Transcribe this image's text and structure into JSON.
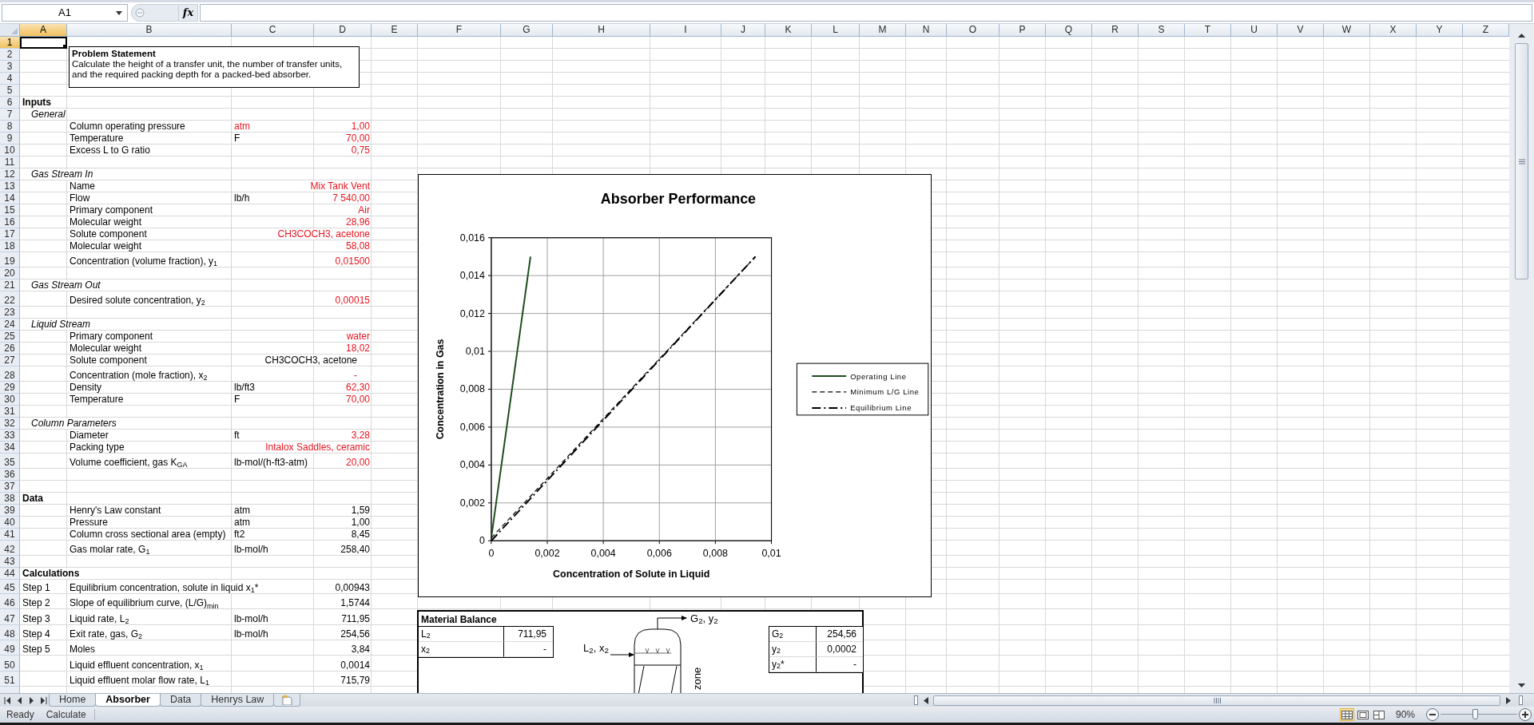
{
  "formula_bar": {
    "name_box": "A1",
    "function_label": "fx"
  },
  "columns": [
    {
      "label": "A",
      "selected": true
    },
    {
      "label": "B",
      "selected": false
    },
    {
      "label": "C",
      "selected": false
    },
    {
      "label": "D",
      "selected": false
    },
    {
      "label": "E",
      "selected": false
    },
    {
      "label": "F",
      "selected": false
    },
    {
      "label": "G",
      "selected": false
    },
    {
      "label": "H",
      "selected": false
    },
    {
      "label": "I",
      "selected": false
    },
    {
      "label": "J",
      "selected": false
    },
    {
      "label": "K",
      "selected": false
    },
    {
      "label": "L",
      "selected": false
    },
    {
      "label": "M",
      "selected": false
    },
    {
      "label": "N",
      "selected": false
    },
    {
      "label": "O",
      "selected": false
    },
    {
      "label": "P",
      "selected": false
    },
    {
      "label": "Q",
      "selected": false
    },
    {
      "label": "R",
      "selected": false
    },
    {
      "label": "S",
      "selected": false
    },
    {
      "label": "T",
      "selected": false
    },
    {
      "label": "U",
      "selected": false
    },
    {
      "label": "V",
      "selected": false
    },
    {
      "label": "W",
      "selected": false
    },
    {
      "label": "X",
      "selected": false
    },
    {
      "label": "Y",
      "selected": false
    },
    {
      "label": "Z",
      "selected": false
    }
  ],
  "rows": [
    {
      "number": "1",
      "selected": true,
      "cells": {}
    },
    {
      "number": "2",
      "selected": false,
      "cells": {}
    },
    {
      "number": "3",
      "selected": false,
      "cells": {}
    },
    {
      "number": "4",
      "selected": false,
      "cells": {}
    },
    {
      "number": "5",
      "selected": false,
      "cells": {}
    },
    {
      "number": "6",
      "selected": false,
      "cells": {
        "a": {
          "text": "Inputs",
          "input": false,
          "kind": "heading"
        }
      }
    },
    {
      "number": "7",
      "selected": false,
      "cells": {
        "a": {
          "text": "General",
          "input": false,
          "kind": "subheading"
        }
      }
    },
    {
      "number": "8",
      "selected": false,
      "cells": {
        "b": {
          "text": "Column operating pressure",
          "input": false
        },
        "c": {
          "text": "atm",
          "input": true
        },
        "d": {
          "text": "1,00",
          "input": true
        }
      }
    },
    {
      "number": "9",
      "selected": false,
      "cells": {
        "b": {
          "text": "Temperature",
          "input": false
        },
        "c": {
          "text": "F",
          "input": false
        },
        "d": {
          "text": "70,00",
          "input": true
        }
      }
    },
    {
      "number": "10",
      "selected": false,
      "cells": {
        "b": {
          "text": "Excess L to G ratio",
          "input": false
        },
        "d": {
          "text": "0,75",
          "input": true
        }
      }
    },
    {
      "number": "11",
      "selected": false,
      "cells": {}
    },
    {
      "number": "12",
      "selected": false,
      "cells": {
        "a": {
          "text": "Gas Stream In",
          "input": false,
          "kind": "subheading"
        }
      }
    },
    {
      "number": "13",
      "selected": false,
      "cells": {
        "b": {
          "text": "Name",
          "input": false
        },
        "d": {
          "text": "Mix Tank Vent",
          "input": true
        }
      }
    },
    {
      "number": "14",
      "selected": false,
      "cells": {
        "b": {
          "text": "Flow",
          "input": false
        },
        "c": {
          "text": "lb/h",
          "input": false
        },
        "d": {
          "text": "7 540,00",
          "input": true
        }
      }
    },
    {
      "number": "15",
      "selected": false,
      "cells": {
        "b": {
          "text": "Primary component",
          "input": false
        },
        "d": {
          "text": "Air",
          "input": true
        }
      }
    },
    {
      "number": "16",
      "selected": false,
      "cells": {
        "b": {
          "text": "Molecular weight",
          "input": false
        },
        "d": {
          "text": "28,96",
          "input": true
        }
      }
    },
    {
      "number": "17",
      "selected": false,
      "cells": {
        "b": {
          "text": "Solute component",
          "input": false
        },
        "d": {
          "text": "CH3COCH3, acetone",
          "input": true
        }
      }
    },
    {
      "number": "18",
      "selected": false,
      "cells": {
        "b": {
          "text": "Molecular weight",
          "input": false
        },
        "d": {
          "text": "58,08",
          "input": true
        }
      }
    },
    {
      "number": "19",
      "selected": false,
      "cells": {
        "b": {
          "text": "Concentration (volume fraction), y$_{1}$",
          "input": false
        },
        "d": {
          "text": "0,01500",
          "input": true
        }
      }
    },
    {
      "number": "20",
      "selected": false,
      "cells": {}
    },
    {
      "number": "21",
      "selected": false,
      "cells": {
        "a": {
          "text": "Gas Stream Out",
          "input": false,
          "kind": "subheading"
        }
      }
    },
    {
      "number": "22",
      "selected": false,
      "cells": {
        "b": {
          "text": "Desired solute concentration, y$_{2}$",
          "input": false
        },
        "d": {
          "text": "0,00015",
          "input": true
        }
      }
    },
    {
      "number": "23",
      "selected": false,
      "cells": {}
    },
    {
      "number": "24",
      "selected": false,
      "cells": {
        "a": {
          "text": "Liquid Stream",
          "input": false,
          "kind": "subheading"
        }
      }
    },
    {
      "number": "25",
      "selected": false,
      "cells": {
        "b": {
          "text": "Primary component",
          "input": false
        },
        "d": {
          "text": "water",
          "input": true
        }
      }
    },
    {
      "number": "26",
      "selected": false,
      "cells": {
        "b": {
          "text": "Molecular weight",
          "input": false
        },
        "d": {
          "text": "18,02",
          "input": true
        }
      }
    },
    {
      "number": "27",
      "selected": false,
      "cells": {
        "b": {
          "text": "Solute component",
          "input": false
        },
        "d": {
          "text": "CH3COCH3, acetone",
          "input": false,
          "kind": "accounting"
        }
      }
    },
    {
      "number": "28",
      "selected": false,
      "cells": {
        "b": {
          "text": "Concentration (mole fraction), x$_{2}$",
          "input": false
        },
        "d": {
          "text": "-",
          "input": true,
          "kind": "accounting"
        }
      }
    },
    {
      "number": "29",
      "selected": false,
      "cells": {
        "b": {
          "text": "Density",
          "input": false
        },
        "c": {
          "text": "lb/ft3",
          "input": false
        },
        "d": {
          "text": "62,30",
          "input": true
        }
      }
    },
    {
      "number": "30",
      "selected": false,
      "cells": {
        "b": {
          "text": "Temperature",
          "input": false
        },
        "c": {
          "text": "F",
          "input": false
        },
        "d": {
          "text": "70,00",
          "input": true
        }
      }
    },
    {
      "number": "31",
      "selected": false,
      "cells": {}
    },
    {
      "number": "32",
      "selected": false,
      "cells": {
        "a": {
          "text": "Column Parameters",
          "input": false,
          "kind": "subheading"
        }
      }
    },
    {
      "number": "33",
      "selected": false,
      "cells": {
        "b": {
          "text": "Diameter",
          "input": false
        },
        "c": {
          "text": "ft",
          "input": false
        },
        "d": {
          "text": "3,28",
          "input": true
        }
      }
    },
    {
      "number": "34",
      "selected": false,
      "cells": {
        "b": {
          "text": "Packing type",
          "input": false
        },
        "d": {
          "text": "Intalox Saddles, ceramic",
          "input": true
        }
      }
    },
    {
      "number": "35",
      "selected": false,
      "cells": {
        "b": {
          "text": "Volume coefficient, gas K$_{GA}$",
          "input": false
        },
        "c": {
          "text": "lb-mol/(h-ft3-atm)",
          "input": false
        },
        "d": {
          "text": "20,00",
          "input": true
        }
      }
    },
    {
      "number": "36",
      "selected": false,
      "cells": {}
    },
    {
      "number": "37",
      "selected": false,
      "cells": {}
    },
    {
      "number": "38",
      "selected": false,
      "cells": {
        "a": {
          "text": "Data",
          "input": false,
          "kind": "heading"
        }
      }
    },
    {
      "number": "39",
      "selected": false,
      "cells": {
        "b": {
          "text": "Henry's Law constant",
          "input": false
        },
        "c": {
          "text": "atm",
          "input": false
        },
        "d": {
          "text": "1,59",
          "input": false
        }
      }
    },
    {
      "number": "40",
      "selected": false,
      "cells": {
        "b": {
          "text": "Pressure",
          "input": false
        },
        "c": {
          "text": "atm",
          "input": false
        },
        "d": {
          "text": "1,00",
          "input": false
        }
      }
    },
    {
      "number": "41",
      "selected": false,
      "cells": {
        "b": {
          "text": "Column cross sectional area (empty)",
          "input": false
        },
        "c": {
          "text": "ft2",
          "input": false
        },
        "d": {
          "text": "8,45",
          "input": false
        }
      }
    },
    {
      "number": "42",
      "selected": false,
      "cells": {
        "b": {
          "text": "Gas molar rate, G$_{1}$",
          "input": false
        },
        "c": {
          "text": "lb-mol/h",
          "input": false
        },
        "d": {
          "text": "258,40",
          "input": false
        }
      }
    },
    {
      "number": "43",
      "selected": false,
      "cells": {}
    },
    {
      "number": "44",
      "selected": false,
      "cells": {
        "a": {
          "text": "Calculations",
          "input": false,
          "kind": "heading"
        }
      }
    },
    {
      "number": "45",
      "selected": false,
      "cells": {
        "a": {
          "text": "Step 1",
          "input": false
        },
        "b": {
          "text": "Equilibrium concentration, solute in liquid x$_{1}$*",
          "input": false
        },
        "d": {
          "text": "0,00943",
          "input": false
        }
      }
    },
    {
      "number": "46",
      "selected": false,
      "cells": {
        "a": {
          "text": "Step 2",
          "input": false
        },
        "b": {
          "text": "Slope of equilibrium curve, (L/G)$_{min}$",
          "input": false
        },
        "d": {
          "text": "1,5744",
          "input": false
        }
      }
    },
    {
      "number": "47",
      "selected": false,
      "cells": {
        "a": {
          "text": "Step 3",
          "input": false
        },
        "b": {
          "text": "Liquid rate, L$_{2}$",
          "input": false
        },
        "c": {
          "text": "lb-mol/h",
          "input": false
        },
        "d": {
          "text": "711,95",
          "input": false
        }
      }
    },
    {
      "number": "48",
      "selected": false,
      "cells": {
        "a": {
          "text": "Step 4",
          "input": false
        },
        "b": {
          "text": "Exit rate, gas, G$_{2}$",
          "input": false
        },
        "c": {
          "text": "lb-mol/h",
          "input": false
        },
        "d": {
          "text": "254,56",
          "input": false
        }
      }
    },
    {
      "number": "49",
      "selected": false,
      "cells": {
        "a": {
          "text": "Step 5",
          "input": false
        },
        "b": {
          "text": "Moles",
          "input": false
        },
        "d": {
          "text": "3,84",
          "input": false
        }
      }
    },
    {
      "number": "50",
      "selected": false,
      "cells": {
        "b": {
          "text": "Liquid effluent concentration, x$_{1}$",
          "input": false
        },
        "d": {
          "text": "0,0014",
          "input": false
        }
      }
    },
    {
      "number": "51",
      "selected": false,
      "cells": {
        "b": {
          "text": "Liquid effluent molar flow rate, L$_{1}$",
          "input": false
        },
        "d": {
          "text": "715,79",
          "input": false
        }
      }
    }
  ],
  "problem_statement": {
    "title": "Problem Statement",
    "text": "Calculate the height of a transfer unit, the number of transfer units, and the required packing depth for a packed-bed absorber."
  },
  "chart": {
    "chart_data": {
      "type": "line",
      "title": "Absorber Performance",
      "xlabel": "Concentration of Solute in Liquid",
      "ylabel": "Concentration in Gas",
      "x": [
        0,
        0.0014,
        0.00943
      ],
      "series": [
        {
          "name": "Operating Line",
          "color": "#1e4d1e",
          "line_style": "solid",
          "values": [
            0.00015,
            0.015,
            null
          ]
        },
        {
          "name": "Minimum L/G Line",
          "color": "#000000",
          "line_style": "dashed",
          "values": [
            0.00015,
            0.00235,
            0.015
          ]
        },
        {
          "name": "Equilibrium Line",
          "color": "#000000",
          "line_style": "dashdot",
          "values": [
            0,
            0.00223,
            0.015
          ]
        }
      ],
      "xlim": [
        0,
        0.01
      ],
      "ylim": [
        0,
        0.016
      ],
      "grid": true,
      "legend": true,
      "xticks": [
        {
          "value": 0,
          "label": "0"
        },
        {
          "value": 0.002,
          "label": "0,002"
        },
        {
          "value": 0.004,
          "label": "0,004"
        },
        {
          "value": 0.006,
          "label": "0,006"
        },
        {
          "value": 0.008,
          "label": "0,008"
        },
        {
          "value": 0.01,
          "label": "0,01"
        }
      ],
      "yticks": [
        {
          "value": 0,
          "label": "0"
        },
        {
          "value": 0.002,
          "label": "0,002"
        },
        {
          "value": 0.004,
          "label": "0,004"
        },
        {
          "value": 0.006,
          "label": "0,006"
        },
        {
          "value": 0.008,
          "label": "0,008"
        },
        {
          "value": 0.01,
          "label": "0,01"
        },
        {
          "value": 0.012,
          "label": "0,012"
        },
        {
          "value": 0.014,
          "label": "0,014"
        },
        {
          "value": 0.016,
          "label": "0,016"
        }
      ]
    }
  },
  "material_balance": {
    "title": "Material Balance",
    "inlet_table": [
      {
        "label": "L$_{2}$",
        "value": "711,95"
      },
      {
        "label": "x$_{2}$",
        "value": "-"
      }
    ],
    "outlet_table": [
      {
        "label": "G$_{2}$",
        "value": "254,56"
      },
      {
        "label": "y$_{2}$",
        "value": "0,0002"
      },
      {
        "label": "y$_{2}$*",
        "value": "-"
      }
    ],
    "gas_out_label": "G$_{2}$, y$_{2}$",
    "liquid_in_label": "L$_{2}$, x$_{2}$",
    "zone_label": "zone"
  },
  "sheet_tabs": [
    {
      "label": "Home",
      "selected": false
    },
    {
      "label": "Absorber",
      "selected": true
    },
    {
      "label": "Data",
      "selected": false
    },
    {
      "label": "Henrys Law",
      "selected": false
    }
  ],
  "status_bar": {
    "mode": "Ready",
    "calc": "Calculate",
    "views": [
      {
        "kind": "normal",
        "selected": true
      },
      {
        "kind": "page-layout",
        "selected": false
      },
      {
        "kind": "page-break",
        "selected": false
      }
    ],
    "zoom": "90%",
    "zoom_slider": {
      "level": 0.45
    }
  }
}
